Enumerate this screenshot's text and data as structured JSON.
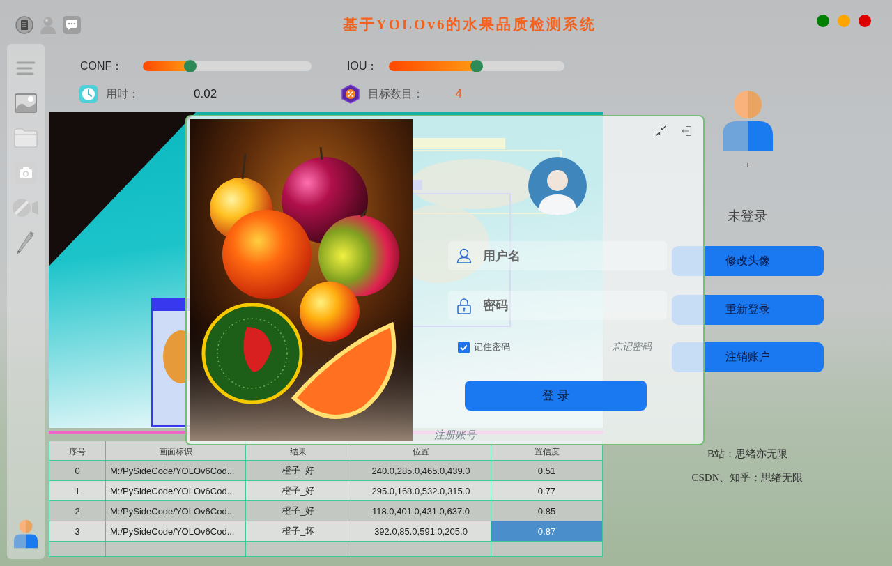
{
  "title": "基于YOLOv6的水果品质检测系统",
  "window_controls": [
    {
      "color": "#008000"
    },
    {
      "color": "#ffa500"
    },
    {
      "color": "#dd0000"
    }
  ],
  "sliders": [
    {
      "label": "CONF：",
      "level": 0.28
    },
    {
      "label": "IOU：",
      "level": 0.5
    }
  ],
  "stats": [
    {
      "kind": "time",
      "label": "用时：",
      "value": "0.02"
    },
    {
      "kind": "count",
      "label": "目标数目：",
      "value": "4"
    }
  ],
  "table": {
    "columns": [
      "序号",
      "画面标识",
      "结果",
      "位置",
      "置信度"
    ],
    "rows": [
      {
        "cells": [
          {
            "text": "0",
            "selected": false
          },
          {
            "text": "M:/PySideCode/YOLOv6Cod...",
            "selected": false
          },
          {
            "text": "橙子_好",
            "selected": false
          },
          {
            "text": "240.0,285.0,465.0,439.0",
            "selected": false
          },
          {
            "text": "0.51",
            "selected": false
          }
        ]
      },
      {
        "cells": [
          {
            "text": "1",
            "selected": false
          },
          {
            "text": "M:/PySideCode/YOLOv6Cod...",
            "selected": false
          },
          {
            "text": "橙子_好",
            "selected": false
          },
          {
            "text": "295.0,168.0,532.0,315.0",
            "selected": false
          },
          {
            "text": "0.77",
            "selected": false
          }
        ]
      },
      {
        "cells": [
          {
            "text": "2",
            "selected": false
          },
          {
            "text": "M:/PySideCode/YOLOv6Cod...",
            "selected": false
          },
          {
            "text": "橙子_好",
            "selected": false
          },
          {
            "text": "118.0,401.0,431.0,637.0",
            "selected": false
          },
          {
            "text": "0.85",
            "selected": false
          }
        ]
      },
      {
        "cells": [
          {
            "text": "3",
            "selected": false
          },
          {
            "text": "M:/PySideCode/YOLOv6Cod...",
            "selected": false
          },
          {
            "text": "橙子_坏",
            "selected": false
          },
          {
            "text": "392.0,85.0,591.0,205.0",
            "selected": false
          },
          {
            "text": "0.87",
            "selected": true
          }
        ]
      }
    ]
  },
  "profile": {
    "avatar_plus": "+",
    "status": "未登录",
    "buttons": [
      "修改头像",
      "重新登录",
      "注销账户"
    ],
    "credits": [
      "B站：思绪亦无限",
      "CSDN、知乎：思绪无限"
    ]
  },
  "login_dialog": {
    "username": {
      "placeholder": "用户名"
    },
    "password": {
      "placeholder": "密码"
    },
    "remember": {
      "label": "记住密码",
      "checked": true
    },
    "forgot_link": "忘记密码",
    "login_button": "登 录",
    "register_link": "注册账号"
  }
}
